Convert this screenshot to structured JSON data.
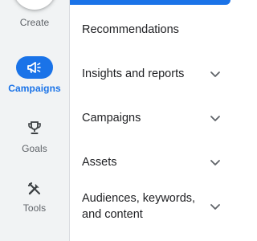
{
  "rail": {
    "create_label": "Create",
    "items": [
      {
        "label": "Campaigns",
        "icon": "megaphone-icon",
        "active": true
      },
      {
        "label": "Goals",
        "icon": "trophy-icon",
        "active": false
      },
      {
        "label": "Tools",
        "icon": "tools-icon",
        "active": false
      }
    ]
  },
  "menu": {
    "items": [
      {
        "label": "Recommendations",
        "expandable": false
      },
      {
        "label": "Insights and reports",
        "expandable": true
      },
      {
        "label": "Campaigns",
        "expandable": true
      },
      {
        "label": "Assets",
        "expandable": true
      },
      {
        "label_line1": "Audiences, keywords,",
        "label_line2": "and content",
        "expandable": true
      }
    ]
  },
  "colors": {
    "accent": "#1a73e8",
    "rail_bg": "#f1f3f4",
    "text": "#202124",
    "muted": "#5f6368"
  }
}
